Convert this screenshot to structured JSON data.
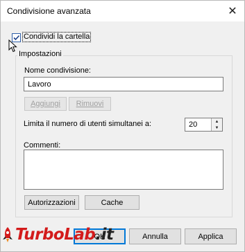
{
  "window": {
    "title": "Condivisione avanzata",
    "close_glyph": "✕"
  },
  "share_checkbox": {
    "checked": true,
    "label": "Condividi la cartella"
  },
  "settings": {
    "legend": "Impostazioni",
    "share_name_label": "Nome condivisione:",
    "share_name_value": "Lavoro",
    "add_button": "Aggiungi",
    "remove_button": "Rimuovi",
    "limit_label": "Limita il numero di utenti simultanei a:",
    "limit_value": "20",
    "comments_label": "Commenti:",
    "comments_value": "",
    "permissions_button": "Autorizzazioni",
    "cache_button": "Cache"
  },
  "footer": {
    "ok_button": "OK",
    "cancel_button": "Annulla",
    "apply_button": "Applica"
  },
  "watermark": {
    "text_part1": "TurboLab",
    "text_part2": ".it"
  },
  "colors": {
    "accent": "#0078d7",
    "watermark_red": "#d31b1b"
  }
}
